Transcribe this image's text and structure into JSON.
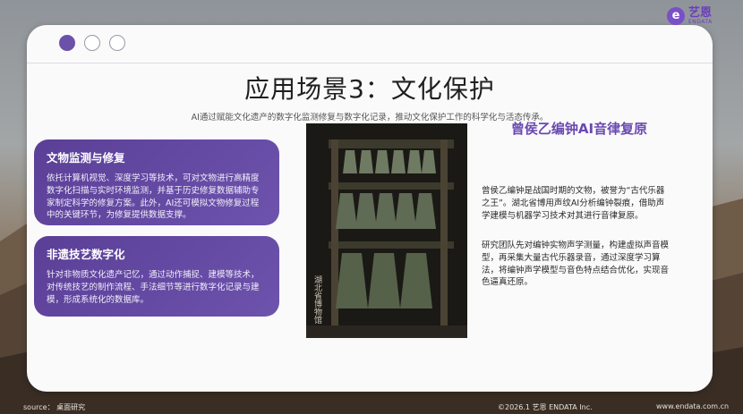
{
  "slide": {
    "title": "应用场景3：文化保护",
    "subtitle": "AI通过赋能文化遗产的数字化监测修复与数字化记录，推动文化保护工作的科学化与活态传承。"
  },
  "boxes": [
    {
      "heading": "文物监测与修复",
      "body": "依托计算机视觉、深度学习等技术，可对文物进行高精度数字化扫描与实时环境监测，并基于历史修复数据辅助专家制定科学的修复方案。此外，AI还可模拟文物修复过程中的关键环节，为修复提供数据支撑。"
    },
    {
      "heading": "非遗技艺数字化",
      "body": "针对非物质文化遗产记忆，通过动作捕捉、建模等技术，对传统技艺的制作流程、手法细节等进行数字化记录与建模，形成系统化的数据库。"
    }
  ],
  "case": {
    "title": "曾侯乙编钟AI音律复原",
    "para1": "曾侯乙编钟是战国时期的文物，被誉为“古代乐器之王”。湖北省博用声纹AI分析编钟裂痕，借助声学建模与机器学习技术对其进行音律复原。",
    "para2": "研究团队先对编钟实物声学测量，构建虚拟声音模型，再采集大量古代乐器录音，通过深度学习算法，将编钟声学模型与音色特点结合优化，实现音色逼真还原。",
    "photo_caption": "湖北省博物馆"
  },
  "logo": {
    "cn": "艺恩",
    "en": "ENDATA",
    "mark": "e"
  },
  "footer": {
    "source": "source：  桌面研究",
    "copyright": "©2026.1  艺恩 ENDATA Inc.",
    "website": "www.endata.com.cn"
  },
  "colors": {
    "accent": "#6b52a8",
    "box_bg": "#5b3f97",
    "title_purple": "#6a49b0"
  }
}
